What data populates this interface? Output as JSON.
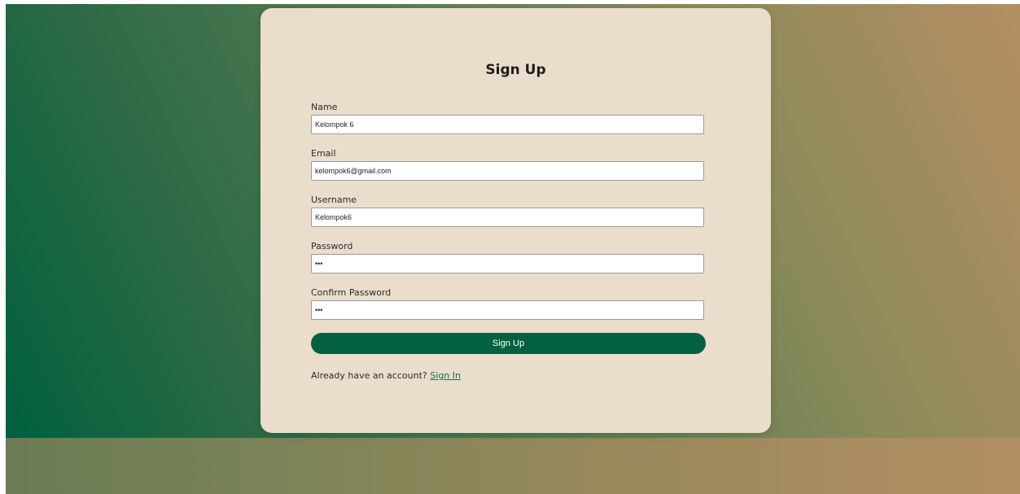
{
  "form": {
    "title": "Sign Up",
    "fields": [
      {
        "label": "Name",
        "value": "Kelompok 6"
      },
      {
        "label": "Email",
        "value": "kelompok6@gmail.com"
      },
      {
        "label": "Username",
        "value": "Kelompok6"
      },
      {
        "label": "Password",
        "value": "•••"
      },
      {
        "label": "Confirm Password",
        "value": "•••"
      }
    ],
    "submit_label": "Sign Up",
    "signin_prompt": "Already have an account?",
    "signin_link": "Sign In"
  },
  "colors": {
    "card_background": "#eaddcc",
    "button_background": "#036140",
    "link": "#1f6a4a"
  }
}
